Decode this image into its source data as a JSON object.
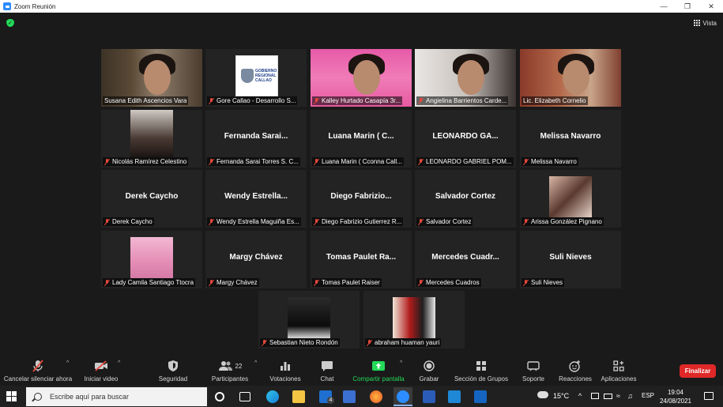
{
  "window": {
    "title": "Zoom Reunión"
  },
  "header": {
    "view_label": "Vista"
  },
  "participants": [
    {
      "display": "video",
      "label": "Susana Edith Ascencios Vara",
      "muted": false
    },
    {
      "display": "logo",
      "label": "Gore Callao - Desarrollo S...",
      "muted": true,
      "logo_text": [
        "GOBIERNO",
        "REGIONAL",
        "CALLAO"
      ]
    },
    {
      "display": "video",
      "label": "Kalley Hurtado Casapía 3r...",
      "muted": true
    },
    {
      "display": "video",
      "label": "Angielina Barrientos Carde...",
      "muted": true
    },
    {
      "display": "video",
      "label": "Lic. Elizabeth Cornelio",
      "muted": false,
      "active_speaker": true
    },
    {
      "display": "photo",
      "label": "Nicolás Ramírez Celestino",
      "muted": true
    },
    {
      "display": "name",
      "big_name": "Fernanda Sarai...",
      "label": "Fernanda Sarai Torres S. C...",
      "muted": true
    },
    {
      "display": "name",
      "big_name": "Luana Marin ( C...",
      "label": "Luana Marin ( Cconna Call...",
      "muted": true
    },
    {
      "display": "name",
      "big_name": "LEONARDO GA...",
      "label": "LEONARDO GABRIEL POM...",
      "muted": true
    },
    {
      "display": "name",
      "big_name": "Melissa Navarro",
      "label": "Melissa Navarro",
      "muted": true
    },
    {
      "display": "name",
      "big_name": "Derek Caycho",
      "label": "Derek Caycho",
      "muted": true
    },
    {
      "display": "name",
      "big_name": "Wendy Estrella...",
      "label": "Wendy Estrella Maguiña Es...",
      "muted": true
    },
    {
      "display": "name",
      "big_name": "Diego Fabrizio...",
      "label": "Diego Fabrizio Gutierrez R...",
      "muted": true
    },
    {
      "display": "name",
      "big_name": "Salvador Cortez",
      "label": "Salvador Cortez",
      "muted": true
    },
    {
      "display": "photo",
      "label": "Arissa González Pignano",
      "muted": true
    },
    {
      "display": "photo",
      "label": "Lady Camila Santiago Ttocra",
      "muted": true
    },
    {
      "display": "name",
      "big_name": "Margy Chávez",
      "label": "Margy Chávez",
      "muted": true
    },
    {
      "display": "name",
      "big_name": "Tomas Paulet Ra...",
      "label": "Tomas Paulet Raiser",
      "muted": true
    },
    {
      "display": "name",
      "big_name": "Mercedes Cuadr...",
      "label": "Mercedes Cuadros",
      "muted": true
    },
    {
      "display": "name",
      "big_name": "Suli Nieves",
      "label": "Suli Nieves",
      "muted": true
    },
    {
      "display": "photo",
      "label": "Sebastian Nieto Rondón",
      "muted": true
    },
    {
      "display": "photo",
      "label": "abraham huaman yauri",
      "muted": true
    }
  ],
  "toolbar": {
    "mute_label": "Cancelar silenciar ahora",
    "video_label": "Iniciar video",
    "security_label": "Seguridad",
    "participants_label": "Participantes",
    "participants_count": "22",
    "polls_label": "Votaciones",
    "chat_label": "Chat",
    "share_label": "Compartir pantalla",
    "record_label": "Grabar",
    "breakout_label": "Sección de Grupos",
    "support_label": "Soporte",
    "reactions_label": "Reacciones",
    "apps_label": "Aplicaciones",
    "end_label": "Finalizar"
  },
  "colors": {
    "share_green": "#23d959",
    "end_red": "#e02828",
    "active_outline": "#c9e44b",
    "muted_red": "#e8493c"
  },
  "taskbar": {
    "search_placeholder": "Escribe aquí para buscar",
    "mail_badge": "4",
    "weather": "15°C",
    "language": "ESP",
    "time": "19:04",
    "date": "24/08/2021"
  }
}
